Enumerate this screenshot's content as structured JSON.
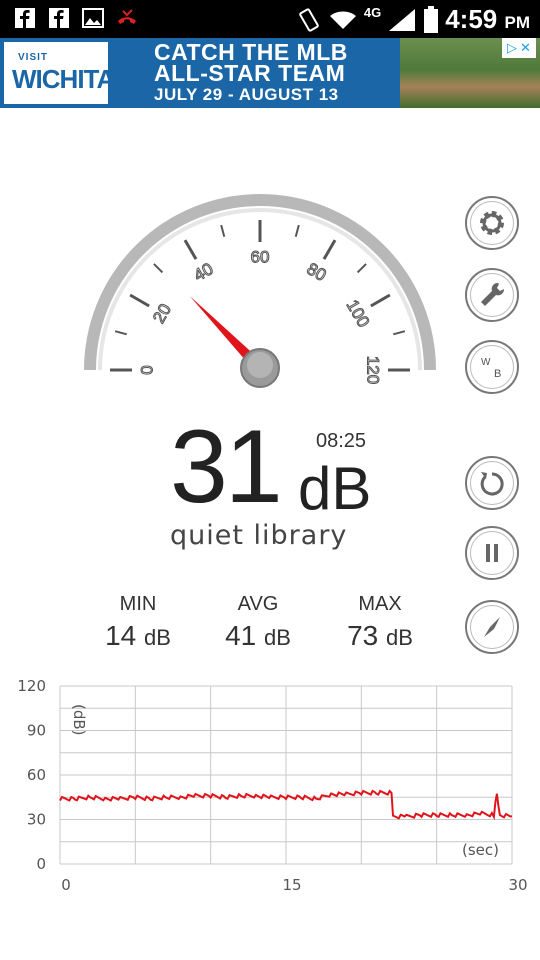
{
  "status_bar": {
    "time": "4:59",
    "ampm": "PM",
    "network": "4G",
    "icons": [
      "facebook-icon",
      "facebook-icon",
      "gallery-icon",
      "missed-call-icon",
      "vibrate-icon",
      "wifi-icon",
      "signal-icon",
      "battery-icon"
    ]
  },
  "ad": {
    "logo_small": "VISIT",
    "logo_big": "WICHITA",
    "line1": "CATCH THE MLB",
    "line2": "ALL-STAR TEAM",
    "line3": "JULY 29 - AUGUST 13",
    "adchoices_icon": "adchoices-icon",
    "close_icon": "close-icon"
  },
  "gauge": {
    "ticks": [
      "0",
      "20",
      "40",
      "60",
      "80",
      "100",
      "120"
    ],
    "max": 120,
    "needle_value": 31,
    "colors": {
      "needle": "#e0151b",
      "arc": "#c8c8c8",
      "hub": "#9a9a9a"
    }
  },
  "reading": {
    "value": "31",
    "unit": "dB",
    "timer": "08:25",
    "description": "quiet library"
  },
  "stats": [
    {
      "label": "MIN",
      "value": "14",
      "unit": "dB"
    },
    {
      "label": "AVG",
      "value": "41",
      "unit": "dB"
    },
    {
      "label": "MAX",
      "value": "73",
      "unit": "dB"
    }
  ],
  "side_buttons": [
    {
      "name": "settings-button",
      "icon": "gear-icon"
    },
    {
      "name": "calibrate-button",
      "icon": "wrench-icon"
    },
    {
      "name": "weighting-button",
      "icon": "weighting-icon",
      "label_w": "W",
      "label_b": "B"
    },
    {
      "name": "reset-button",
      "icon": "reset-icon"
    },
    {
      "name": "pause-button",
      "icon": "pause-icon"
    },
    {
      "name": "compass-button",
      "icon": "compass-icon"
    }
  ],
  "chart_data": {
    "type": "line",
    "title": "",
    "ylabel": "(dB)",
    "xlabel": "(sec)",
    "xlim": [
      0,
      30
    ],
    "ylim": [
      0,
      120
    ],
    "x_ticks": [
      "0",
      "15",
      "30"
    ],
    "y_ticks": [
      "0",
      "30",
      "60",
      "90",
      "120"
    ],
    "grid": true,
    "series": [
      {
        "color": "#e0151b",
        "points": [
          [
            0,
            44
          ],
          [
            1,
            44
          ],
          [
            2,
            45
          ],
          [
            3,
            44
          ],
          [
            4,
            44
          ],
          [
            5,
            45
          ],
          [
            6,
            44
          ],
          [
            7,
            45
          ],
          [
            8,
            45
          ],
          [
            9,
            46
          ],
          [
            10,
            46
          ],
          [
            11,
            45
          ],
          [
            12,
            46
          ],
          [
            13,
            46
          ],
          [
            14,
            45
          ],
          [
            15,
            45
          ],
          [
            16,
            45
          ],
          [
            17,
            44
          ],
          [
            18,
            47
          ],
          [
            19,
            47
          ],
          [
            20,
            48
          ],
          [
            21,
            48
          ],
          [
            22,
            48
          ],
          [
            22.1,
            32
          ],
          [
            23,
            32
          ],
          [
            24,
            33
          ],
          [
            25,
            33
          ],
          [
            26,
            33
          ],
          [
            27,
            33
          ],
          [
            28,
            34
          ],
          [
            28.8,
            33
          ],
          [
            29,
            48
          ],
          [
            29.2,
            33
          ],
          [
            30,
            32
          ]
        ]
      }
    ]
  }
}
